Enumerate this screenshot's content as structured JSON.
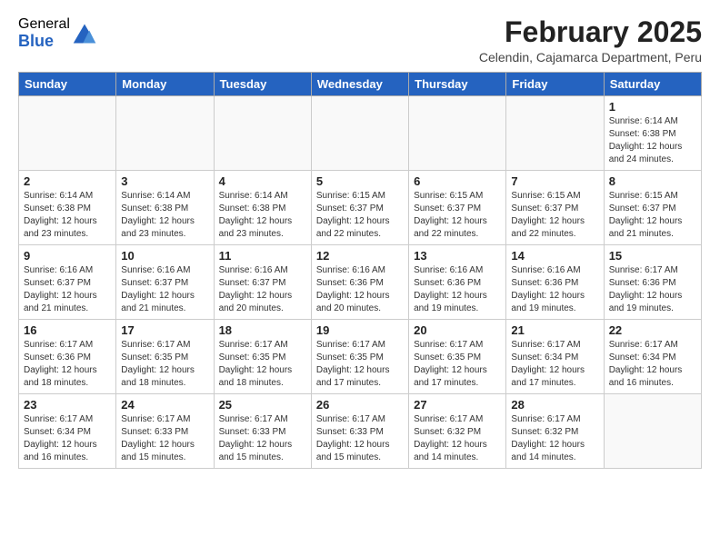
{
  "logo": {
    "general": "General",
    "blue": "Blue"
  },
  "header": {
    "month": "February 2025",
    "location": "Celendin, Cajamarca Department, Peru"
  },
  "weekdays": [
    "Sunday",
    "Monday",
    "Tuesday",
    "Wednesday",
    "Thursday",
    "Friday",
    "Saturday"
  ],
  "weeks": [
    [
      {
        "day": "",
        "detail": ""
      },
      {
        "day": "",
        "detail": ""
      },
      {
        "day": "",
        "detail": ""
      },
      {
        "day": "",
        "detail": ""
      },
      {
        "day": "",
        "detail": ""
      },
      {
        "day": "",
        "detail": ""
      },
      {
        "day": "1",
        "detail": "Sunrise: 6:14 AM\nSunset: 6:38 PM\nDaylight: 12 hours\nand 24 minutes."
      }
    ],
    [
      {
        "day": "2",
        "detail": "Sunrise: 6:14 AM\nSunset: 6:38 PM\nDaylight: 12 hours\nand 23 minutes."
      },
      {
        "day": "3",
        "detail": "Sunrise: 6:14 AM\nSunset: 6:38 PM\nDaylight: 12 hours\nand 23 minutes."
      },
      {
        "day": "4",
        "detail": "Sunrise: 6:14 AM\nSunset: 6:38 PM\nDaylight: 12 hours\nand 23 minutes."
      },
      {
        "day": "5",
        "detail": "Sunrise: 6:15 AM\nSunset: 6:37 PM\nDaylight: 12 hours\nand 22 minutes."
      },
      {
        "day": "6",
        "detail": "Sunrise: 6:15 AM\nSunset: 6:37 PM\nDaylight: 12 hours\nand 22 minutes."
      },
      {
        "day": "7",
        "detail": "Sunrise: 6:15 AM\nSunset: 6:37 PM\nDaylight: 12 hours\nand 22 minutes."
      },
      {
        "day": "8",
        "detail": "Sunrise: 6:15 AM\nSunset: 6:37 PM\nDaylight: 12 hours\nand 21 minutes."
      }
    ],
    [
      {
        "day": "9",
        "detail": "Sunrise: 6:16 AM\nSunset: 6:37 PM\nDaylight: 12 hours\nand 21 minutes."
      },
      {
        "day": "10",
        "detail": "Sunrise: 6:16 AM\nSunset: 6:37 PM\nDaylight: 12 hours\nand 21 minutes."
      },
      {
        "day": "11",
        "detail": "Sunrise: 6:16 AM\nSunset: 6:37 PM\nDaylight: 12 hours\nand 20 minutes."
      },
      {
        "day": "12",
        "detail": "Sunrise: 6:16 AM\nSunset: 6:36 PM\nDaylight: 12 hours\nand 20 minutes."
      },
      {
        "day": "13",
        "detail": "Sunrise: 6:16 AM\nSunset: 6:36 PM\nDaylight: 12 hours\nand 19 minutes."
      },
      {
        "day": "14",
        "detail": "Sunrise: 6:16 AM\nSunset: 6:36 PM\nDaylight: 12 hours\nand 19 minutes."
      },
      {
        "day": "15",
        "detail": "Sunrise: 6:17 AM\nSunset: 6:36 PM\nDaylight: 12 hours\nand 19 minutes."
      }
    ],
    [
      {
        "day": "16",
        "detail": "Sunrise: 6:17 AM\nSunset: 6:36 PM\nDaylight: 12 hours\nand 18 minutes."
      },
      {
        "day": "17",
        "detail": "Sunrise: 6:17 AM\nSunset: 6:35 PM\nDaylight: 12 hours\nand 18 minutes."
      },
      {
        "day": "18",
        "detail": "Sunrise: 6:17 AM\nSunset: 6:35 PM\nDaylight: 12 hours\nand 18 minutes."
      },
      {
        "day": "19",
        "detail": "Sunrise: 6:17 AM\nSunset: 6:35 PM\nDaylight: 12 hours\nand 17 minutes."
      },
      {
        "day": "20",
        "detail": "Sunrise: 6:17 AM\nSunset: 6:35 PM\nDaylight: 12 hours\nand 17 minutes."
      },
      {
        "day": "21",
        "detail": "Sunrise: 6:17 AM\nSunset: 6:34 PM\nDaylight: 12 hours\nand 17 minutes."
      },
      {
        "day": "22",
        "detail": "Sunrise: 6:17 AM\nSunset: 6:34 PM\nDaylight: 12 hours\nand 16 minutes."
      }
    ],
    [
      {
        "day": "23",
        "detail": "Sunrise: 6:17 AM\nSunset: 6:34 PM\nDaylight: 12 hours\nand 16 minutes."
      },
      {
        "day": "24",
        "detail": "Sunrise: 6:17 AM\nSunset: 6:33 PM\nDaylight: 12 hours\nand 15 minutes."
      },
      {
        "day": "25",
        "detail": "Sunrise: 6:17 AM\nSunset: 6:33 PM\nDaylight: 12 hours\nand 15 minutes."
      },
      {
        "day": "26",
        "detail": "Sunrise: 6:17 AM\nSunset: 6:33 PM\nDaylight: 12 hours\nand 15 minutes."
      },
      {
        "day": "27",
        "detail": "Sunrise: 6:17 AM\nSunset: 6:32 PM\nDaylight: 12 hours\nand 14 minutes."
      },
      {
        "day": "28",
        "detail": "Sunrise: 6:17 AM\nSunset: 6:32 PM\nDaylight: 12 hours\nand 14 minutes."
      },
      {
        "day": "",
        "detail": ""
      }
    ]
  ]
}
